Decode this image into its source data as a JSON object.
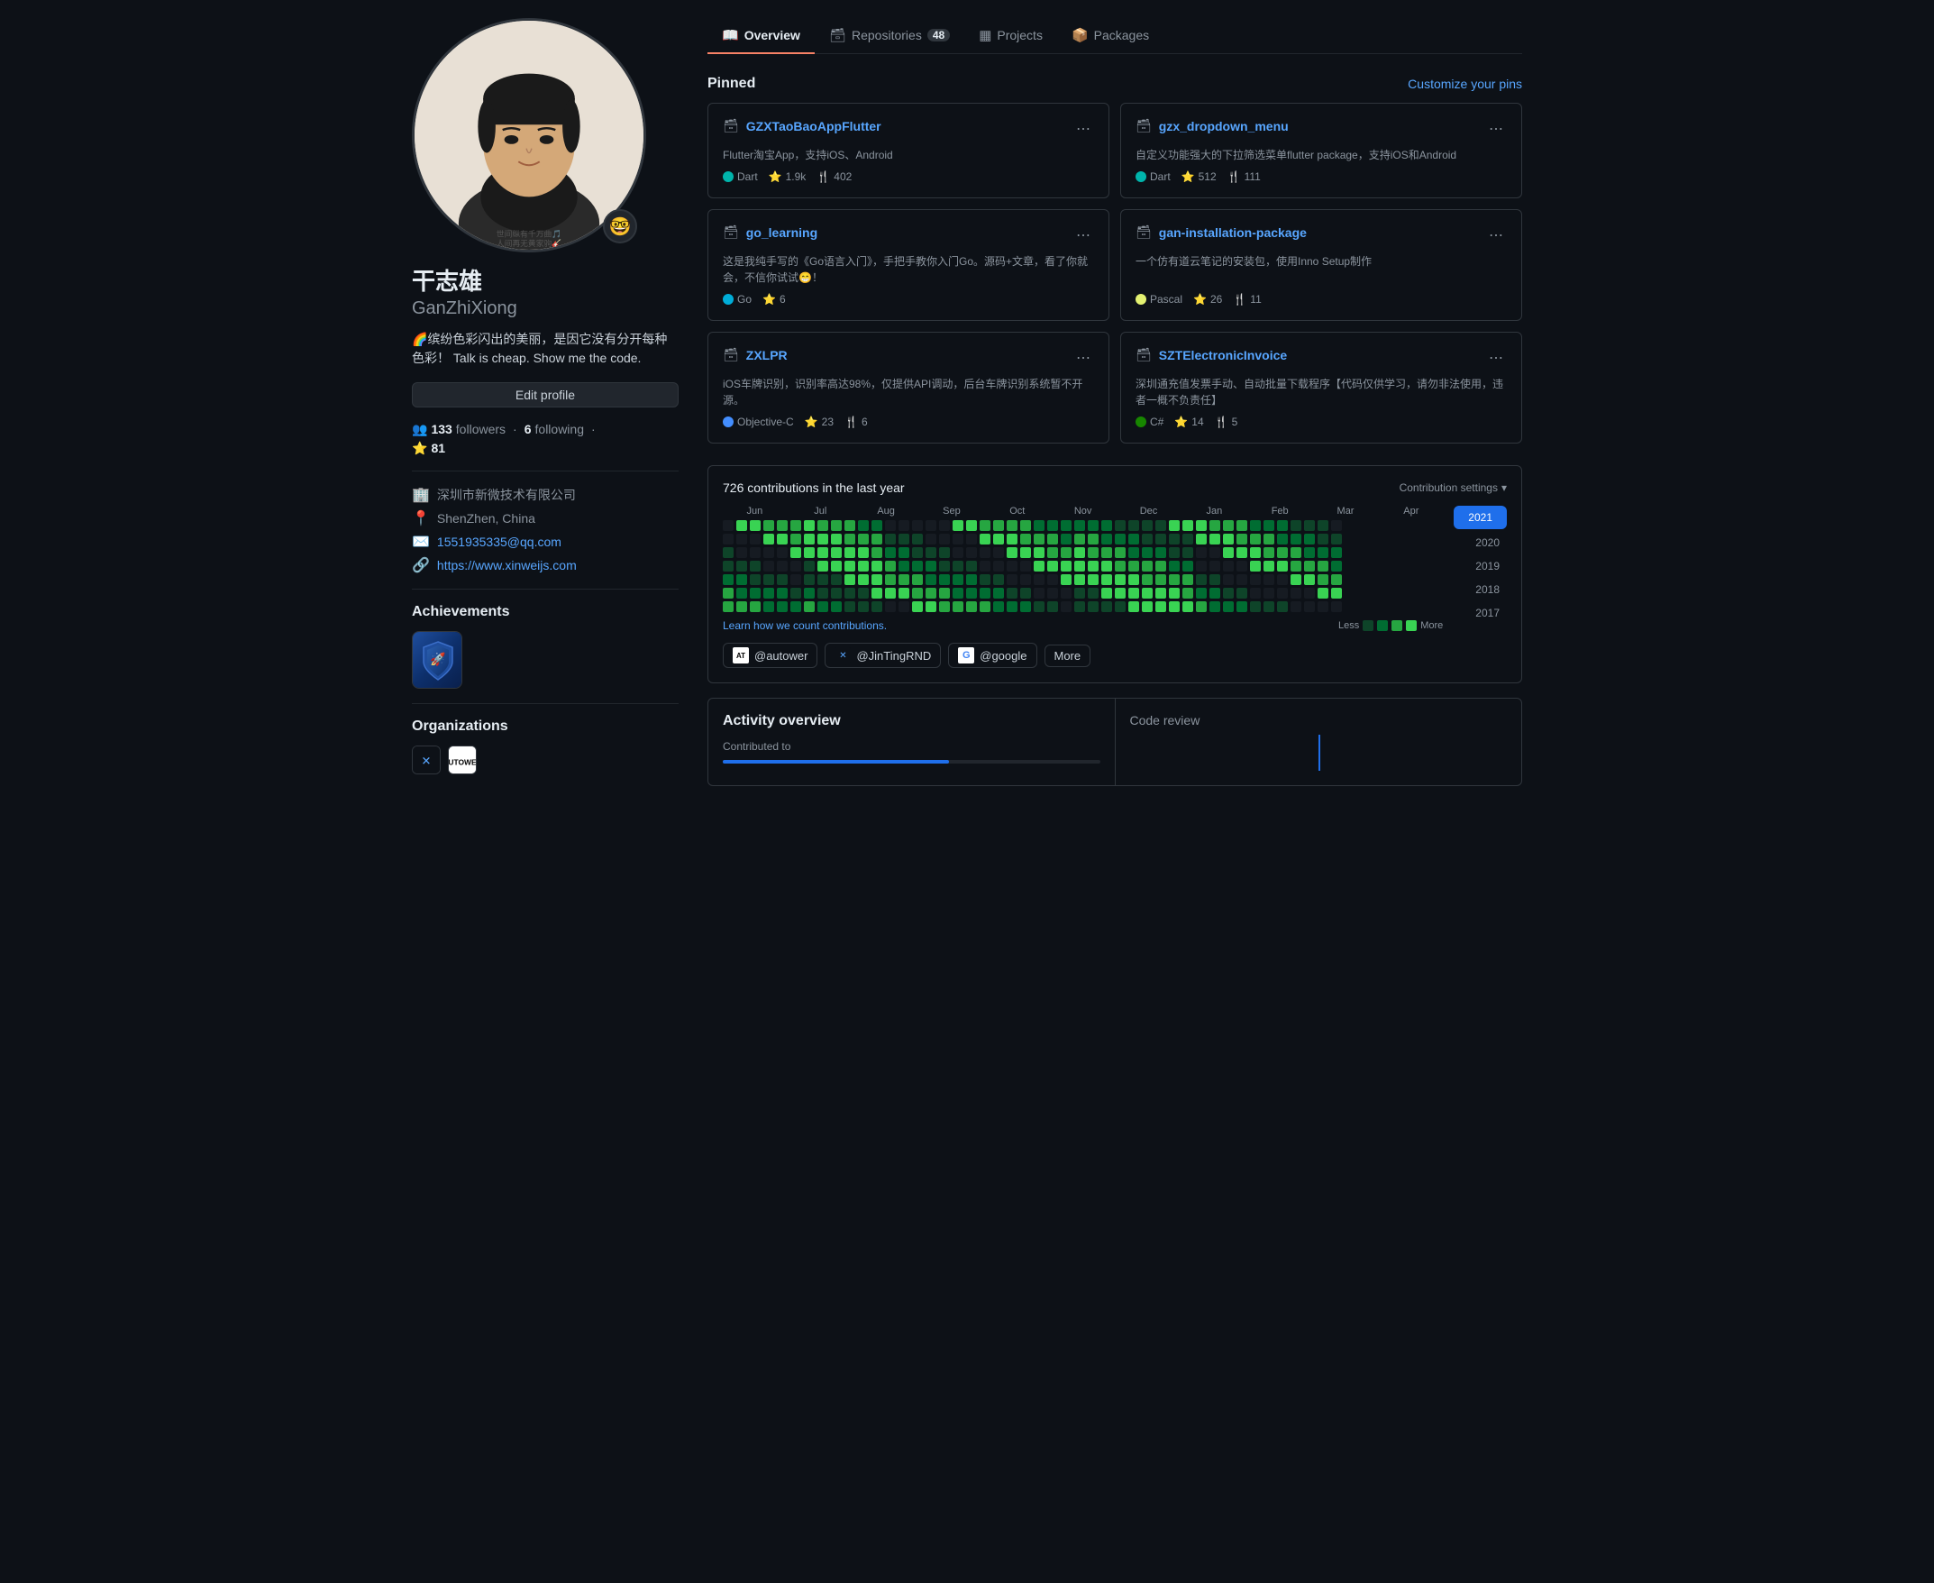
{
  "nav": {
    "tabs": [
      {
        "id": "overview",
        "label": "Overview",
        "icon": "📖",
        "active": true,
        "badge": null
      },
      {
        "id": "repositories",
        "label": "Repositories",
        "icon": "🗃",
        "active": false,
        "badge": "48"
      },
      {
        "id": "projects",
        "label": "Projects",
        "icon": "▦",
        "active": false,
        "badge": null
      },
      {
        "id": "packages",
        "label": "Packages",
        "icon": "📦",
        "active": false,
        "badge": null
      }
    ]
  },
  "sidebar": {
    "display_name": "干志雄",
    "username": "GanZhiXiong",
    "bio": "🌈缤纷色彩闪出的美丽，是因它没有分开每种色彩！ Talk is cheap. Show me the code.",
    "avatar_emoji": "🤓",
    "edit_button": "Edit profile",
    "followers": "133",
    "following": "6",
    "stars": "81",
    "meta": [
      {
        "icon": "🏢",
        "text": "深圳市新微技术有限公司"
      },
      {
        "icon": "📍",
        "text": "ShenZhen, China"
      },
      {
        "icon": "✉️",
        "text": "1551935335@qq.com"
      },
      {
        "icon": "🔗",
        "text": "https://www.xinweijs.com"
      }
    ],
    "achievements_title": "Achievements",
    "orgs_title": "Organizations"
  },
  "pinned": {
    "title": "Pinned",
    "customize_label": "Customize your pins",
    "repos": [
      {
        "name": "GZXTaoBaoAppFlutter",
        "desc": "Flutter淘宝App，支持iOS、Android",
        "lang": "Dart",
        "lang_color": "#00B4AB",
        "stars": "1.9k",
        "forks": "402"
      },
      {
        "name": "gzx_dropdown_menu",
        "desc": "自定义功能强大的下拉筛选菜单flutter package，支持iOS和Android",
        "lang": "Dart",
        "lang_color": "#00B4AB",
        "stars": "512",
        "forks": "111"
      },
      {
        "name": "go_learning",
        "desc": "这是我纯手写的《Go语言入门》，手把手教你入门Go。源码+文章，看了你就会，不信你试试😁！",
        "lang": "Go",
        "lang_color": "#00ADD8",
        "stars": "6",
        "forks": null
      },
      {
        "name": "gan-installation-package",
        "desc": "一个仿有道云笔记的安装包，使用Inno Setup制作",
        "lang": "Pascal",
        "lang_color": "#E3F171",
        "stars": "26",
        "forks": "11"
      },
      {
        "name": "ZXLPR",
        "desc": "iOS车牌识别，识别率高达98%，仅提供API调动，后台车牌识别系统暂不开源。",
        "lang": "Objective-C",
        "lang_color": "#438EFF",
        "stars": "23",
        "forks": "6"
      },
      {
        "name": "SZTElectronicInvoice",
        "desc": "深圳通充值发票手动、自动批量下载程序【代码仅供学习，请勿非法使用，违者一概不负责任】",
        "lang": "C#",
        "lang_color": "#178600",
        "stars": "14",
        "forks": "5"
      }
    ]
  },
  "contributions": {
    "title": "726 contributions in the last year",
    "settings_label": "Contribution settings",
    "learn_link": "Learn how we count contributions.",
    "legend_less": "Less",
    "legend_more": "More",
    "years": [
      "2021",
      "2020",
      "2019",
      "2018",
      "2017"
    ],
    "active_year": "2021",
    "months": [
      "Jun",
      "Jul",
      "Aug",
      "Sep",
      "Oct",
      "Nov",
      "Dec",
      "Jan",
      "Feb",
      "Mar",
      "Apr"
    ]
  },
  "org_filters": [
    {
      "id": "autower",
      "label": "@autower",
      "icon": "AT"
    },
    {
      "id": "jintingrnd",
      "label": "@JinTingRND",
      "icon": "✕"
    },
    {
      "id": "google",
      "label": "@google",
      "icon": "G"
    }
  ],
  "more_button": "More",
  "activity": {
    "title": "Activity overview",
    "code_review_label": "Code review"
  }
}
